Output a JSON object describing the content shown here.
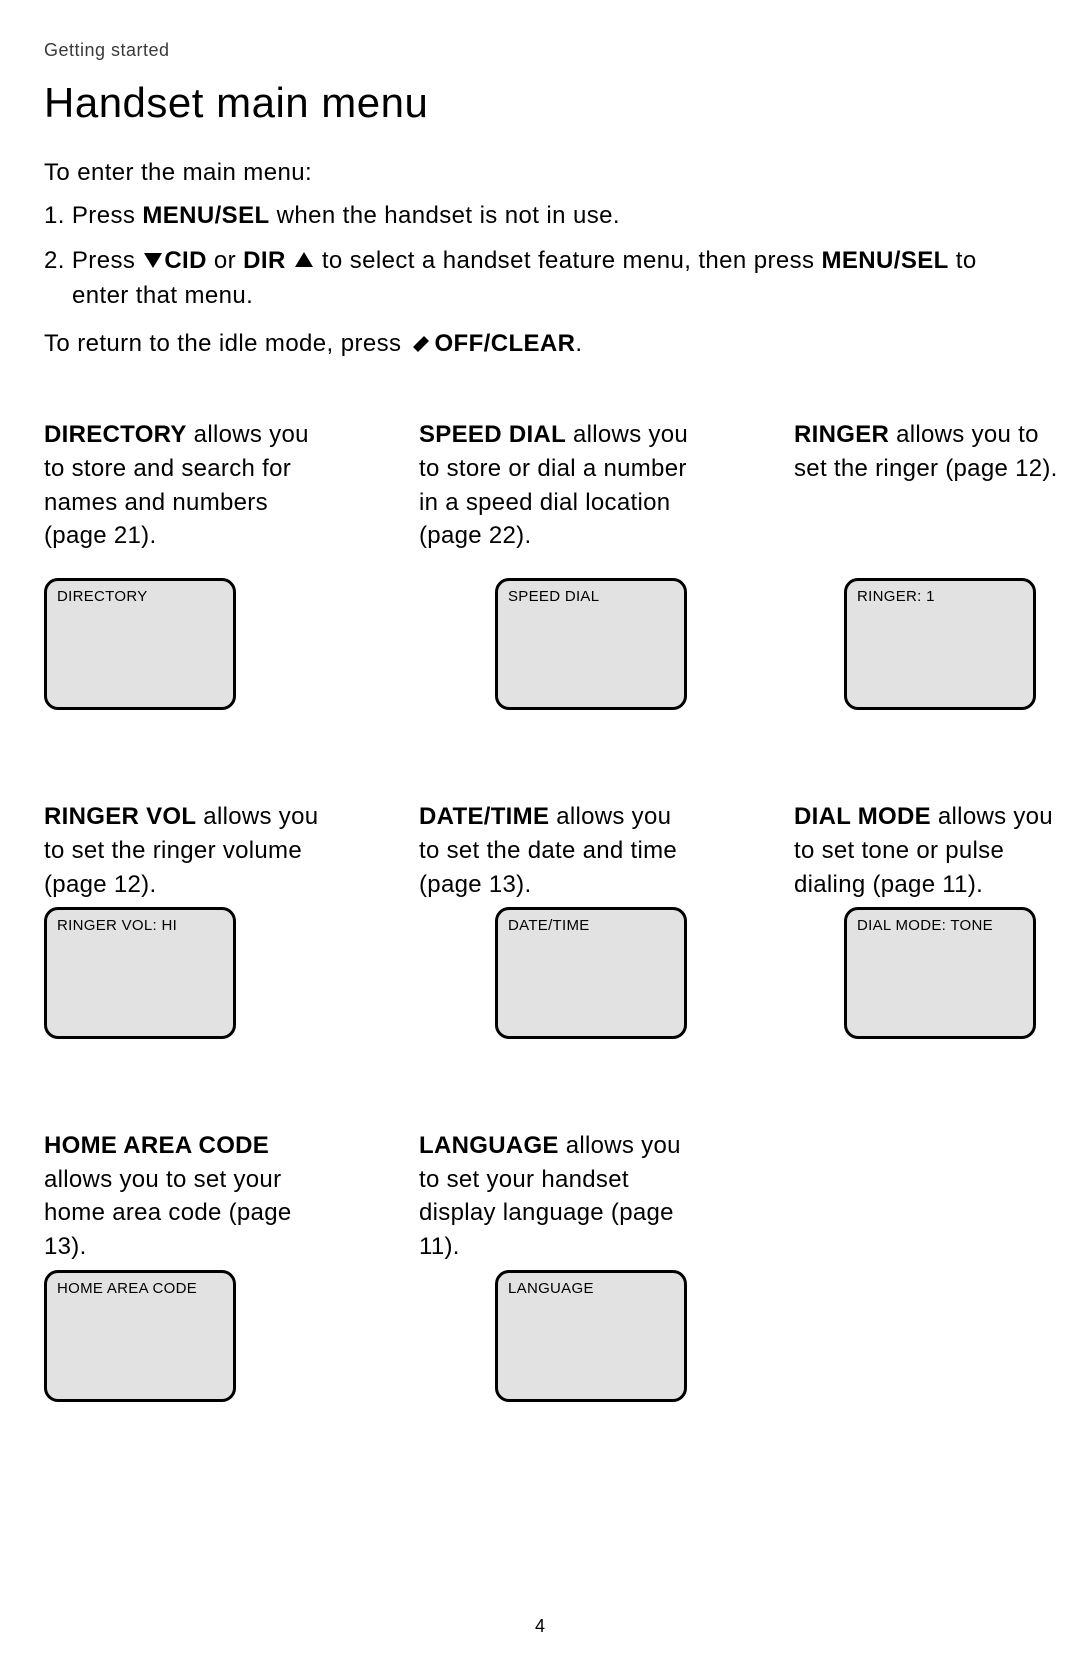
{
  "header": "Getting started",
  "title": "Handset main menu",
  "intro": "To enter the main menu:",
  "step1_prefix": "1. ",
  "step1_a": "Press ",
  "step1_menu": "MENU/",
  "step1_sel": "SEL",
  "step1_b": " when the handset is not in use.",
  "step2_prefix": "2. ",
  "step2_a": "Press ",
  "step2_cid": "CID",
  "step2_or": " or ",
  "step2_dir": "DIR",
  "step2_b": " to select a handset feature menu, then press ",
  "step2_menu": "MENU/",
  "step2_sel": "SEL",
  "step2_c": " to enter that menu.",
  "return_a": "To return to the idle mode, press ",
  "return_off": "OFF/",
  "return_clear": "CLEAR",
  "return_period": ".",
  "pageNumber": "4",
  "menus": {
    "directory": {
      "label": "DIRECTORY",
      "text": " allows you to store and search for names and numbers (page 21).",
      "lcd": "DIRECTORY"
    },
    "speed_dial": {
      "label": "SPEED DIAL",
      "text": " allows you to store or dial a number in a speed dial location (page 22).",
      "lcd": "SPEED DIAL"
    },
    "ringer": {
      "label": "RINGER",
      "text": " allows you to set the ringer (page 12).",
      "lcd": "RINGER: 1"
    },
    "ringer_vol": {
      "label": "RINGER VOL",
      "text": " allows you to set the ringer volume (page 12).",
      "lcd": "RINGER VOL: HI"
    },
    "date_time": {
      "label": "DATE/TIME",
      "text": " allows you to set the date and time (page 13).",
      "lcd": "DATE/TIME"
    },
    "dial_mode": {
      "label": "DIAL MODE",
      "text": " allows you to set tone or pulse dialing (page 11).",
      "lcd": "DIAL MODE: TONE"
    },
    "home_area_code": {
      "label": "HOME AREA CODE",
      "text": " allows you to set your home area code (page 13).",
      "lcd": "HOME AREA CODE"
    },
    "language": {
      "label": "LANGUAGE",
      "text": " allows you to set your handset display language (page 11).",
      "lcd": "LANGUAGE"
    }
  }
}
